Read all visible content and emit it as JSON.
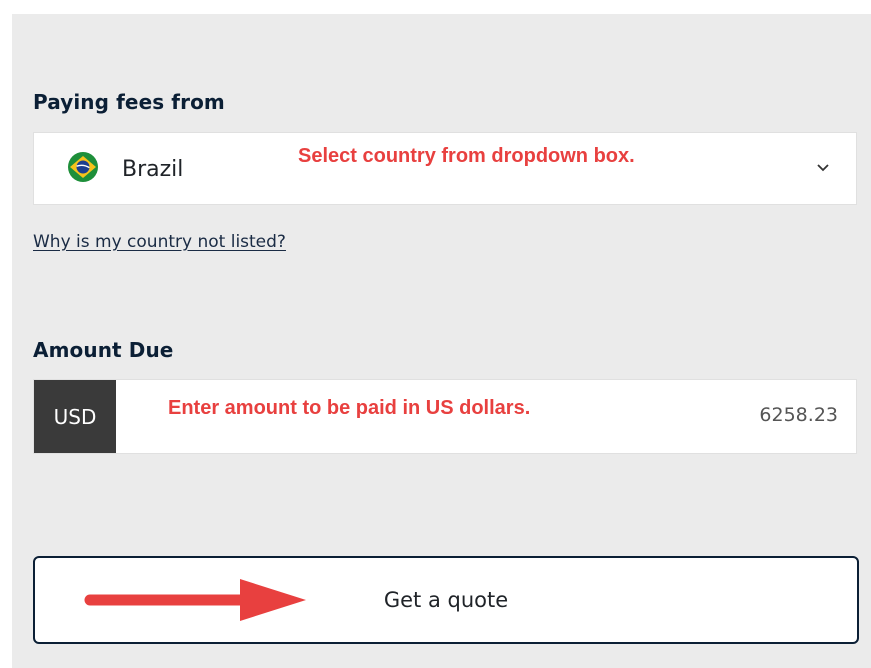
{
  "payment_form": {
    "paying_fees_label": "Paying fees from",
    "country": {
      "selected": "Brazil",
      "flag_icon": "brazil-flag-icon"
    },
    "country_help_link": "Why is my country not listed?",
    "amount_due_label": "Amount Due",
    "currency": "USD",
    "amount_value": "6258.23",
    "quote_button_label": "Get a quote"
  },
  "annotations": {
    "country_hint": "Select country from dropdown box.",
    "amount_hint": "Enter amount to be paid in US dollars.",
    "arrow_icon": "red-arrow-right-icon"
  },
  "colors": {
    "panel_background": "#ebebeb",
    "heading": "#0b1f35",
    "annotation": "#e8403f",
    "currency_box": "#3a3a3a",
    "button_border": "#0b1f35"
  }
}
